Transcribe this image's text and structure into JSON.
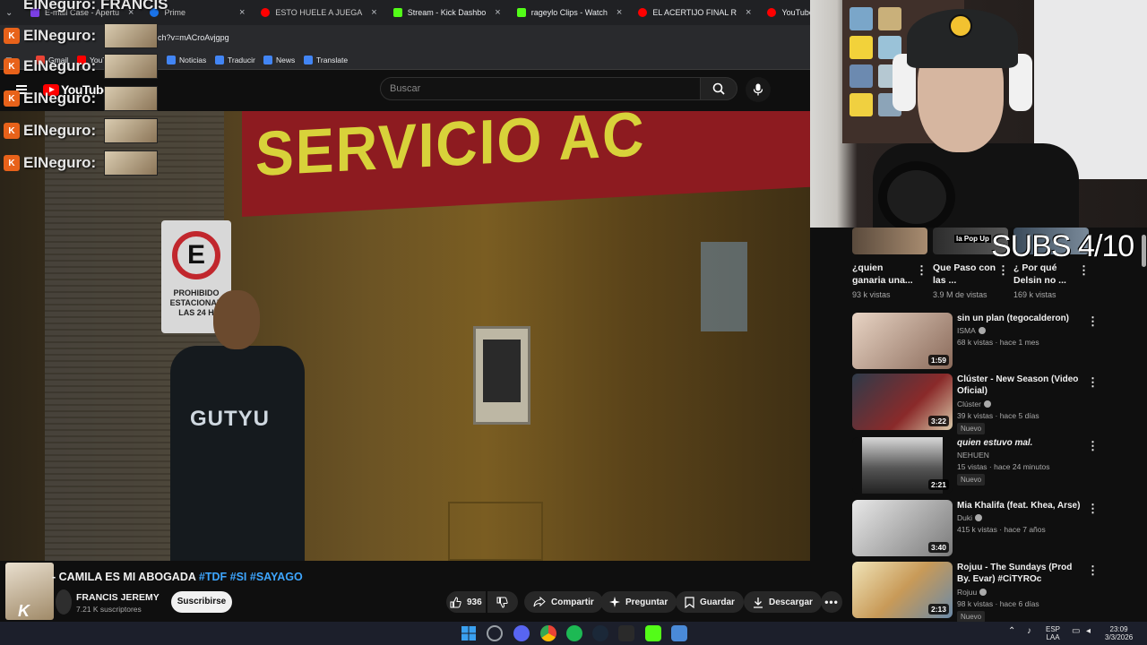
{
  "browser": {
    "tabs": [
      {
        "label": "E-mail Case - Apertu",
        "color": "#7b3fe4"
      },
      {
        "label": "Prime",
        "color": "#1a73e8"
      },
      {
        "label": "ESTO HUELE A JUEGA",
        "color": "#ff0000"
      },
      {
        "label": "Stream - Kick Dashbo",
        "color": "#53fc18"
      },
      {
        "label": "rageylo Clips - Watch",
        "color": "#53fc18"
      },
      {
        "label": "EL ACERTIJO FINAL R",
        "color": "#ff0000"
      },
      {
        "label": "YouTube",
        "color": "#ff0000"
      }
    ],
    "url": "ch?v=mACroAvjgpg",
    "bookmarks": [
      "Gmail",
      "YouTube",
      "Noticias",
      "Traducir",
      "News",
      "Translate"
    ]
  },
  "youtube": {
    "logo_text": "YouTube",
    "search_placeholder": "Buscar"
  },
  "video": {
    "sign_text": "SERVICIO AC",
    "parking_sign_letter": "E",
    "parking_sign_text": "PROHIBIDO ESTACIONAR LAS 24 H",
    "shirt_text": "GUTYU"
  },
  "chat_overlay": {
    "top_text": "ElNeguro: FRANCIS",
    "rows": [
      "ElNeguro:",
      "ElNeguro:",
      "ElNeguro:",
      "ElNeguro:",
      "ElNeguro:"
    ]
  },
  "watch": {
    "title_prefix": "- CAMILA ES MI ABOGADA",
    "hashtags": "#TDF #SI #SAYAGO",
    "channel_name": "FRANCIS JEREMY",
    "subscribers": "7.21 K suscriptores",
    "subscribe_label": "Suscribirse",
    "like_count": "936",
    "share_label": "Compartir",
    "ask_label": "Preguntar",
    "save_label": "Guardar",
    "download_label": "Descargar"
  },
  "stream_overlay": {
    "subs_goal": "SUBS 4/10"
  },
  "shorts": [
    {
      "title": "¿quien ganaria una...",
      "views": "93 k vistas"
    },
    {
      "title": "Que Paso con las ...",
      "views": "3.9 M de vistas"
    },
    {
      "title": "¿ Por qué Delsin no ...",
      "views": "169 k vistas"
    }
  ],
  "short_badge": "la Pop Up",
  "recommendations": [
    {
      "title": "sin un plan (tegocalderon)",
      "channel": "ISMA",
      "verified": true,
      "meta": "68 k vistas · hace 1 mes",
      "duration": "1:59",
      "new": false,
      "italic": false
    },
    {
      "title": "Clúster - New Season (Video Oficial)",
      "channel": "Clúster",
      "verified": true,
      "meta": "39 k vistas · hace 5 días",
      "duration": "3:22",
      "new": true,
      "italic": false
    },
    {
      "title": "quien estuvo mal.",
      "channel": "NEHUEN",
      "verified": false,
      "meta": "15 vistas · hace 24 minutos",
      "duration": "2:21",
      "new": true,
      "italic": true
    },
    {
      "title": "Mia Khalifa (feat. Khea, Arse)",
      "channel": "Duki",
      "verified": true,
      "meta": "415 k vistas · hace 7 años",
      "duration": "3:40",
      "new": false,
      "italic": false
    },
    {
      "title": "Rojuu - The Sundays (Prod By. Evar) #CiTYROc",
      "channel": "Rojuu",
      "verified": true,
      "meta": "98 k vistas · hace 6 días",
      "duration": "2:13",
      "new": true,
      "italic": false
    }
  ],
  "new_label": "Nuevo",
  "taskbar": {
    "lang_top": "ESP",
    "lang_bottom": "LAA",
    "time": "23:09",
    "date": "3/3/2026"
  },
  "colors": {
    "background": "#0f0f0f",
    "link_blue": "#3ea6ff",
    "youtube_red": "#ff0000",
    "kick_green": "#53fc18"
  }
}
